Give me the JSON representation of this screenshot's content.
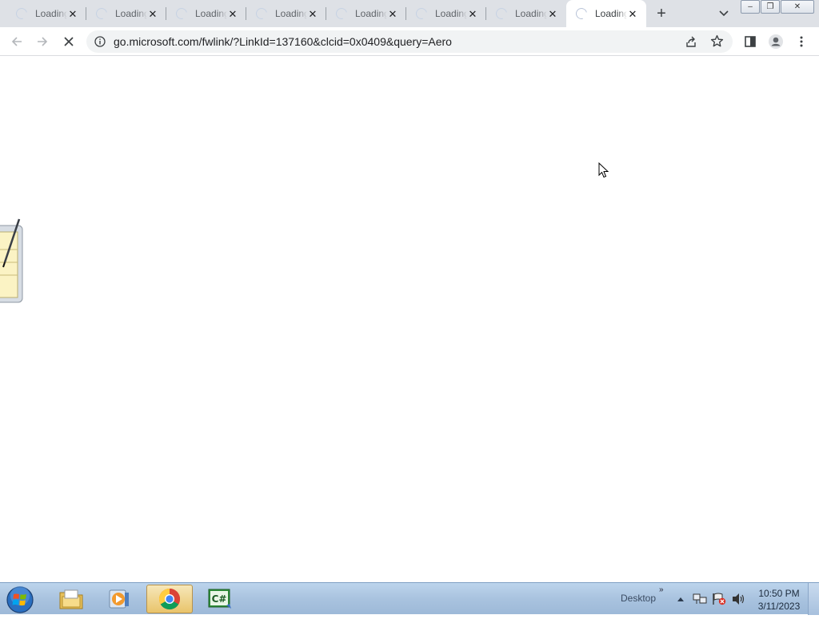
{
  "browser": {
    "tabs": [
      {
        "title": "Loading",
        "active": false
      },
      {
        "title": "Loading",
        "active": false
      },
      {
        "title": "Loading",
        "active": false
      },
      {
        "title": "Loading",
        "active": false
      },
      {
        "title": "Loading",
        "active": false
      },
      {
        "title": "Loading",
        "active": false
      },
      {
        "title": "Loading",
        "active": false
      },
      {
        "title": "Loading",
        "active": true
      }
    ],
    "new_tab_label": "+",
    "tab_close_glyph": "✕",
    "window_buttons": {
      "minimize": "‒",
      "restore": "❐",
      "close": "✕"
    },
    "url": "go.microsoft.com/fwlink/?LinkId=137160&clcid=0x0409&query=Aero"
  },
  "taskbar": {
    "desktop_label": "Desktop",
    "desktop_chevron": "»",
    "clock_time": "10:50 PM",
    "clock_date": "3/11/2023",
    "apps": [
      "windows-explorer",
      "media-player",
      "chrome",
      "csharp-app"
    ],
    "csharp_label": "C#"
  },
  "colors": {
    "tab_strip": "#dee1e6",
    "omnibox": "#f1f3f4",
    "taskbar": "#a9c3df",
    "active_taskbar_item": "#e9c46b"
  }
}
